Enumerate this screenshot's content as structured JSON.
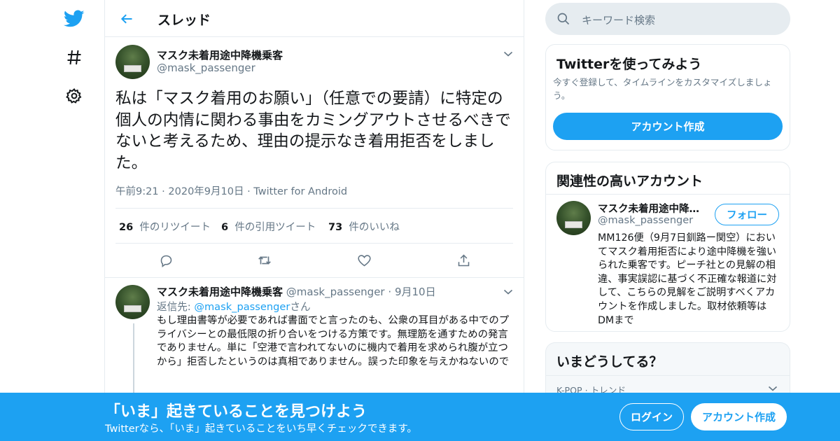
{
  "colors": {
    "accent": "#1da1f2",
    "text": "#14171a",
    "muted": "#657786",
    "border": "#e6ecf0"
  },
  "nav": {
    "icons": [
      "twitter-bird-icon",
      "hashtag-icon",
      "settings-gear-icon"
    ]
  },
  "header": {
    "title": "スレッド"
  },
  "main_tweet": {
    "name": "マスク未着用途中降機乗客",
    "handle": "@mask_passenger",
    "text": "私は「マスク着用のお願い」（任意での要請）に特定の個人の内情に関わる事由をカミングアウトさせるべきでないと考えるため、理由の提示なき着用拒否をしました。",
    "time": "午前9:21",
    "date": "2020年9月10日",
    "source": "Twitter for Android",
    "dot": "·",
    "retweets_count": "26",
    "retweets_label": "件のリツイート",
    "quotes_count": "6",
    "quotes_label": "件の引用ツイート",
    "likes_count": "73",
    "likes_label": "件のいいね"
  },
  "reply_tweet": {
    "name": "マスク未着用途中降機乗客",
    "handle": "@mask_passenger",
    "dot": "·",
    "date": "9月10日",
    "reply_to_prefix": "返信先:",
    "reply_to_handle": "@mask_passenger",
    "reply_to_suffix": "さん",
    "text": "もし理由書等が必要であれば書面でと言ったのも、公衆の耳目がある中でのプライバシーとの最低限の折り合いをつける方策です。無理筋を通すための発言でありません。単に「空港で言われてないのに機内で着用を求められ腹が立つから」拒否したというのは真相でありません。誤った印象を与えかねないので"
  },
  "search": {
    "placeholder": "キーワード検索"
  },
  "signup_card": {
    "title": "Twitterを使ってみよう",
    "desc": "今すぐ登録して、タイムラインをカスタマイズしましょう。",
    "button": "アカウント作成"
  },
  "related_card": {
    "title": "関連性の高いアカウント",
    "name": "マスク未着用途中降機乗客",
    "handle": "@mask_passenger",
    "follow": "フォロー",
    "bio": "MM126便（9月7日釧路ー関空）においてマスク着用拒否により途中降機を強いられた乗客です。ピーチ社との見解の相違、事実誤認に基づく不正確な報道に対して、こちらの見解をご説明すべくアカウントを作成しました。取材依頼等はDMまで"
  },
  "trends_card": {
    "title": "いまどうしてる？",
    "first_category": "K-POP · トレンド"
  },
  "banner": {
    "headline": "「いま」起きていることを見つけよう",
    "sub": "Twitterなら、「いま」起きていることをいち早くチェックできます。",
    "login": "ログイン",
    "signup": "アカウント作成"
  }
}
